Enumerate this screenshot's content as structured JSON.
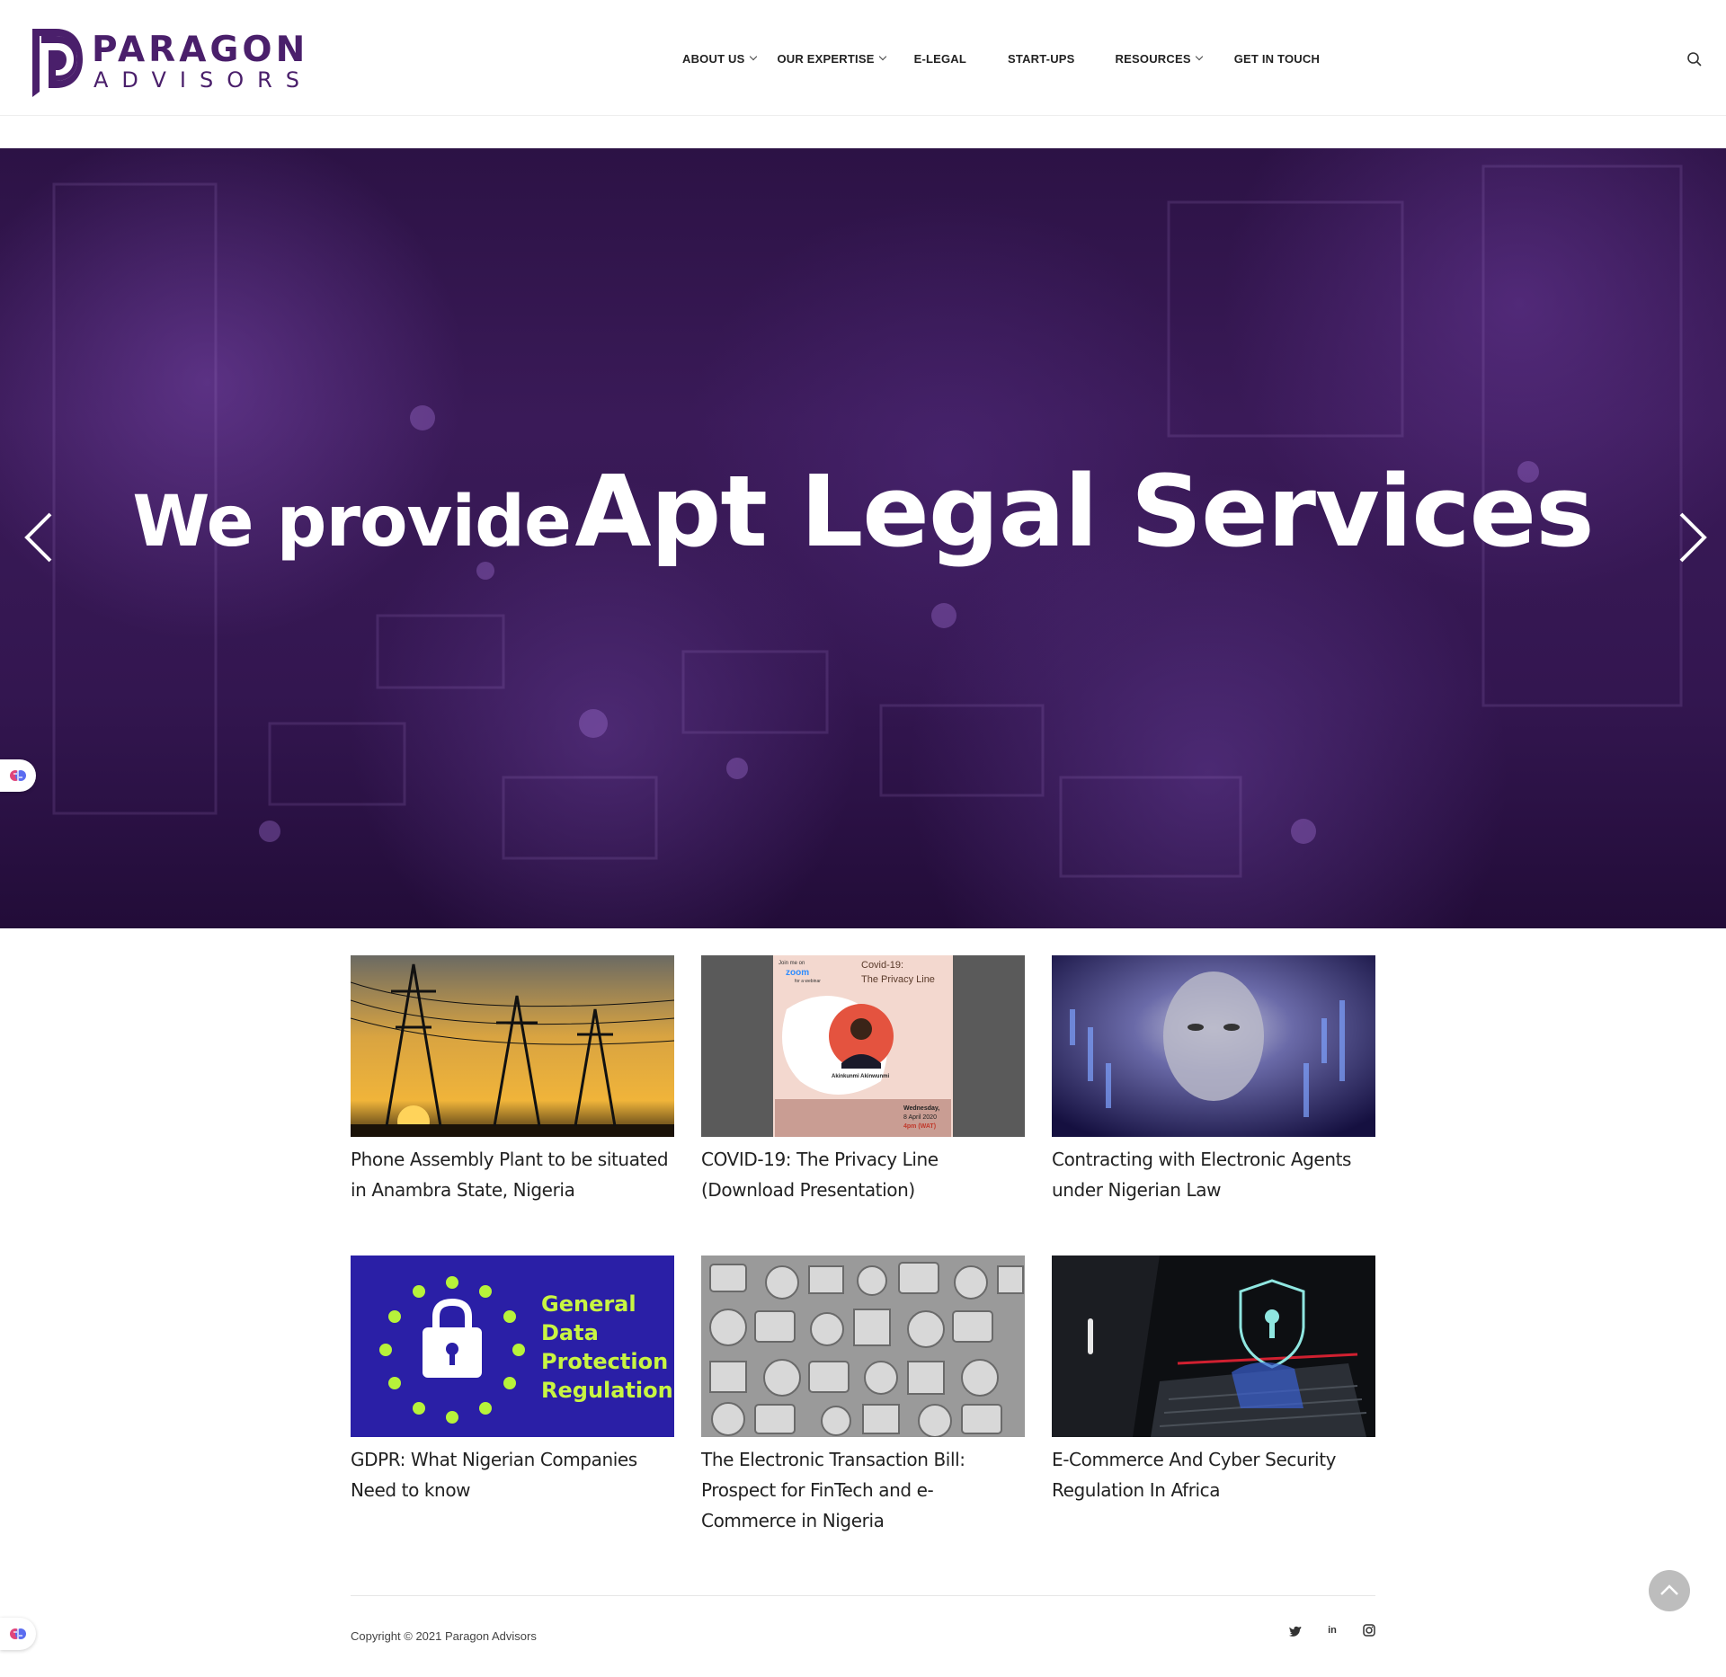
{
  "brand": {
    "name_line1": "PARAGON",
    "name_line2": "ADVISORS",
    "color": "#4a1f6b"
  },
  "nav": {
    "items": [
      {
        "label": "ABOUT US",
        "has_dropdown": true
      },
      {
        "label": "OUR EXPERTISE",
        "has_dropdown": true
      },
      {
        "label": "E-LEGAL",
        "has_dropdown": false
      },
      {
        "label": "START-UPS",
        "has_dropdown": false
      },
      {
        "label": "RESOURCES",
        "has_dropdown": true
      },
      {
        "label": "GET IN TOUCH",
        "has_dropdown": false
      }
    ],
    "search_icon": "search-icon"
  },
  "hero": {
    "text_small": "We provide",
    "text_big": "Apt Legal Services",
    "prev_icon": "chevron-left-icon",
    "next_icon": "chevron-right-icon",
    "overlay_color": "#3a1a58"
  },
  "posts": [
    {
      "title": "Phone Assembly Plant to be situated in Anambra State, Nigeria"
    },
    {
      "title": "COVID-19: The Privacy Line (Download Presentation)",
      "image_text": {
        "join": "Join me on",
        "zoom": "zoom",
        "webinar": "for a webinar",
        "heading": "Covid-19:",
        "subheading": "The Privacy Line",
        "speaker": "Akinkunmi Akinwunmi",
        "date": "Wednesday,",
        "date2": "8 April 2020",
        "time": "4pm (WAT)"
      }
    },
    {
      "title": "Contracting with Electronic Agents under Nigerian Law"
    },
    {
      "title": "GDPR: What Nigerian Companies Need to know",
      "image_text": {
        "line1": "General",
        "line2": "Data",
        "line3": "Protection",
        "line4": "Regulation"
      }
    },
    {
      "title": "The Electronic Transaction Bill: Prospect for FinTech and e-Commerce in Nigeria"
    },
    {
      "title": "E-Commerce And Cyber Security Regulation In Africa"
    }
  ],
  "footer": {
    "copyright": "Copyright © 2021 Paragon Advisors",
    "social_icons": [
      "twitter-icon",
      "linkedin-icon",
      "instagram-icon"
    ],
    "linkedin_label": "in"
  },
  "widgets": {
    "side_icon": "brain-icon",
    "scroll_top_icon": "chevron-up-icon"
  }
}
